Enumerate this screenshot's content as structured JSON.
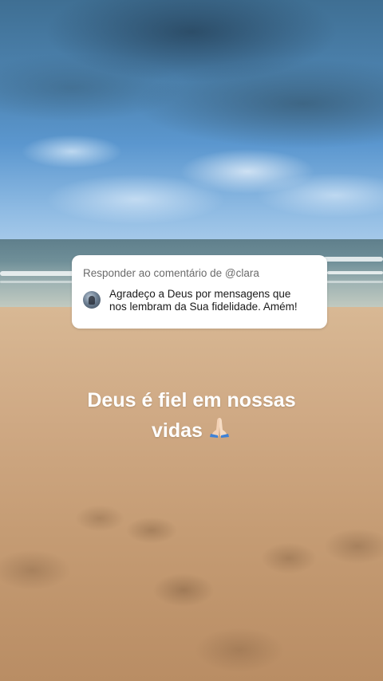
{
  "reply_card": {
    "header": "Responder ao comentário de @clara",
    "comment_text": "Agradeço a Deus por mensagens que\nnos lembram da  Sua fidelidade. Amém!",
    "avatar_icon": "user-avatar"
  },
  "caption": {
    "line1": "Deus é fiel em nossas",
    "line2": "vidas",
    "emoji_icon": "praying-hands-icon"
  },
  "colors": {
    "card_background": "#ffffff",
    "header_text": "#6b6b6b",
    "caption_text": "#ffffff"
  }
}
